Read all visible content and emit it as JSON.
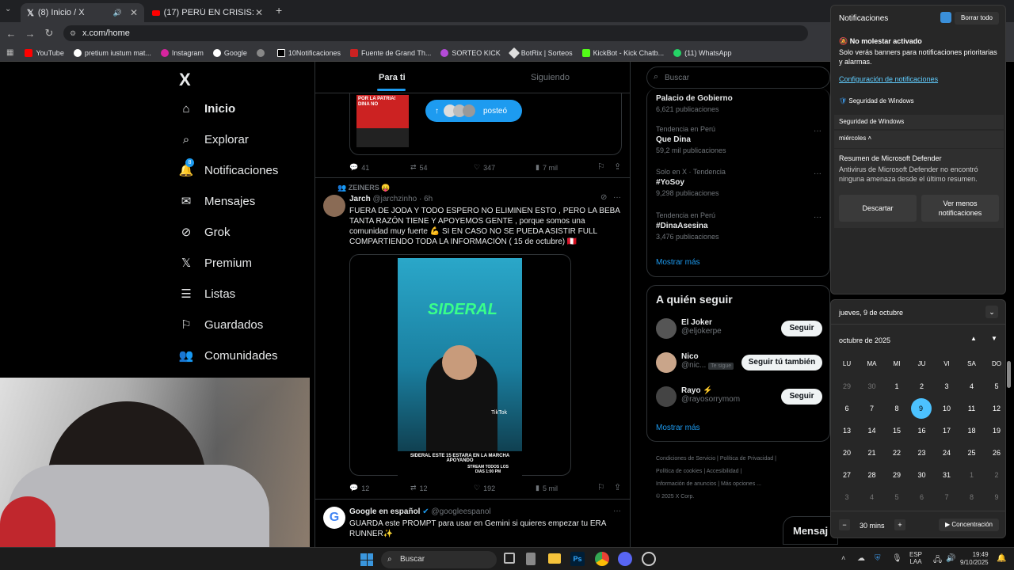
{
  "browser": {
    "tabs": [
      {
        "title": "(8) Inicio / X"
      },
      {
        "title": "(17) PERÚ EN CRISIS: FUERZA P..."
      }
    ],
    "url": "x.com/home",
    "bookmarks": [
      "YouTube",
      "pretium iustum mat...",
      "Instagram",
      "Google",
      "10Notificaciones",
      "Fuente de Grand Th...",
      "SORTEO KICK",
      "BotRix | Sorteos",
      "KickBot - Kick Chatb...",
      "(11) WhatsApp"
    ]
  },
  "sidebar": {
    "logo": "X",
    "items": [
      {
        "label": "Inicio"
      },
      {
        "label": "Explorar"
      },
      {
        "label": "Notificaciones",
        "badge": "8"
      },
      {
        "label": "Mensajes"
      },
      {
        "label": "Grok"
      },
      {
        "label": "Premium"
      },
      {
        "label": "Listas"
      },
      {
        "label": "Guardados"
      },
      {
        "label": "Comunidades"
      }
    ]
  },
  "feed": {
    "tabs": [
      "Para ti",
      "Siguiendo"
    ],
    "posted_label": "posteó",
    "post1_image_text": "POR LA PATRIA! DINA NO",
    "post1_stats": {
      "replies": "41",
      "reposts": "54",
      "likes": "347",
      "views": "7 mil"
    },
    "post2": {
      "context": "ZEINERS 😛",
      "name": "Jarch",
      "handle": "@jarchzinho · 6h",
      "text": "FUERA DE JODA Y TODO ESPERO NO ELIMINEN ESTO , PERO LA BEBA TANTA RAZÓN TIENE Y APOYEMOS GENTE , porque somos una comunidad muy fuerte 💪 SI EN CASO NO SE PUEDA ASISTIR FULL COMPARTIENDO TODA LA INFORMACIÓN ( 15 de octubre) 🇵🇪",
      "video_sign": "SIDERAL",
      "video_caption": "SIDERAL ESTE 15 ESTARA EN LA MARCHA APOYANDO",
      "video_watermark": "TikTok",
      "stream_note": "STREAM TODOS LOS DIAS 1:00 PM",
      "stats": {
        "replies": "12",
        "reposts": "12",
        "likes": "192",
        "views": "5 mil"
      }
    },
    "post3": {
      "name": "Google en español",
      "handle": "@googleespanol",
      "text": "GUARDA este PROMPT para usar en Gemini si quieres empezar tu ERA RUNNER✨"
    }
  },
  "right": {
    "search_placeholder": "Buscar",
    "trends": [
      {
        "context": "",
        "name": "Palacio de Gobierno",
        "count": "6,621 publicaciones"
      },
      {
        "context": "Tendencia en Perú",
        "name": "Que Dina",
        "count": "59,2 mil publicaciones"
      },
      {
        "context": "Solo en X · Tendencia",
        "name": "#YoSoy",
        "count": "9,298 publicaciones"
      },
      {
        "context": "Tendencia en Perú",
        "name": "#DinaAsesina",
        "count": "3,476 publicaciones"
      }
    ],
    "show_more": "Mostrar más",
    "who_title": "A quién seguir",
    "who": [
      {
        "name": "El Joker",
        "handle": "@eljokerpe",
        "btn": "Seguir",
        "note": ""
      },
      {
        "name": "Nico",
        "handle": "@nic...",
        "btn": "Seguir tú también",
        "note": "Te sigue"
      },
      {
        "name": "Rayo ⚡",
        "handle": "@rayosorrymom",
        "btn": "Seguir",
        "note": ""
      }
    ],
    "show_more2": "Mostrar más",
    "footer": [
      "Condiciones de Servicio",
      "Política de Privacidad",
      "Política de cookies",
      "Accesibilidad",
      "Información de anuncios",
      "Más opciones ...",
      "© 2025 X Corp."
    ],
    "messages_label": "Mensaj"
  },
  "notifications": {
    "title": "Notificaciones",
    "clear": "Borrar todo",
    "dnd_title": "No molestar activado",
    "dnd_text": "Solo verás banners para notificaciones prioritarias y alarmas.",
    "settings_link": "Configuración de notificaciones",
    "security_label": "Seguridad de Windows",
    "security_header": "Seguridad de Windows",
    "day": "miércoles",
    "defender_title": "Resumen de Microsoft Defender",
    "defender_text": "Antivirus de Microsoft Defender no encontró ninguna amenaza desde el último resumen.",
    "dismiss": "Descartar",
    "less": "Ver menos notificaciones"
  },
  "calendar": {
    "date_header": "jueves, 9 de octubre",
    "month": "octubre de 2025",
    "weekdays": [
      "LU",
      "MA",
      "MI",
      "JU",
      "VI",
      "SA",
      "DO"
    ],
    "days": [
      "29",
      "30",
      "1",
      "2",
      "3",
      "4",
      "5",
      "6",
      "7",
      "8",
      "9",
      "10",
      "11",
      "12",
      "13",
      "14",
      "15",
      "16",
      "17",
      "18",
      "19",
      "20",
      "21",
      "22",
      "23",
      "24",
      "25",
      "26",
      "27",
      "28",
      "29",
      "30",
      "31",
      "1",
      "2",
      "3",
      "4",
      "5",
      "6",
      "7",
      "8",
      "9"
    ],
    "today": "9",
    "focus_minutes": "30 mins",
    "focus_label": "Concentración"
  },
  "taskbar": {
    "search": "Buscar",
    "lang": "ESP",
    "lang2": "LAA",
    "time": "19:49",
    "date": "9/10/2025"
  }
}
